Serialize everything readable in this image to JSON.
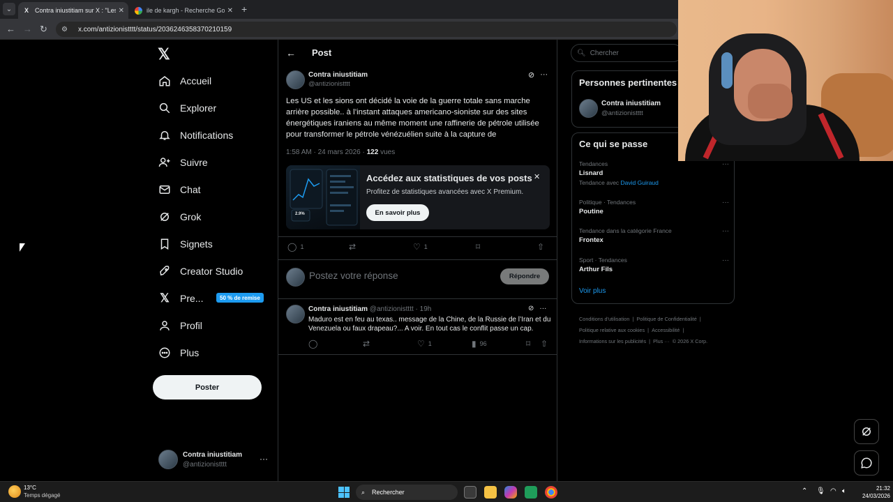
{
  "browser": {
    "tabs": [
      {
        "title": "Contra iniustitiam sur X : \"Les U",
        "favicon": "X"
      },
      {
        "title": "ile de kargh - Recherche Google",
        "favicon": "G"
      }
    ],
    "url": "x.com/antizionistttt/status/2036246358370210159"
  },
  "nav": {
    "items": [
      "Accueil",
      "Explorer",
      "Notifications",
      "Suivre",
      "Chat",
      "Grok",
      "Signets",
      "Creator Studio",
      "Pre...",
      "Profil",
      "Plus"
    ],
    "premium_badge": "50 % de remise",
    "post_button": "Poster",
    "account": {
      "name": "Contra iniustitiam",
      "handle": "@antizionistttt"
    }
  },
  "main": {
    "title": "Post",
    "post": {
      "author": "Contra iniustitiam",
      "handle": "@antizionistttt",
      "text": "Les US et les sions ont décidé la voie de la guerre totale sans marche arrière possible.. à l’instant attaques americano-sioniste sur des sites énergétiques iraniens au même moment une raffinerie de pétrole utilisée pour transformer le pétrole vénézuélien suite à la capture de",
      "time": "1:58 AM · 24 mars 2026 · ",
      "views": "122",
      "views_label": " vues",
      "replies": "1",
      "likes": "1"
    },
    "premium_card": {
      "title": "Accédez aux statistiques de vos posts",
      "subtitle": "Profitez de statistiques avancées avec X Premium.",
      "button": "En savoir plus",
      "img_stat": "2.9%"
    },
    "reply_box": {
      "placeholder": "Postez votre réponse",
      "button": "Répondre"
    },
    "reply": {
      "author": "Contra iniustitiam",
      "handle": "@antizionistttt",
      "time": "· 19h",
      "text": "Maduro est en feu au texas.. message de la Chine, de la Russie de l’Iran et du Venezuela ou faux drapeau?... A voir. En tout cas le conflit passe un cap.",
      "likes": "1",
      "views": "96"
    }
  },
  "right": {
    "search_placeholder": "Chercher",
    "people_title": "Personnes pertinentes",
    "person": {
      "name": "Contra iniustitiam",
      "handle": "@antizionistttt"
    },
    "trends_title": "Ce qui se passe",
    "trends": [
      {
        "category": "Tendances",
        "name": "Lisnard",
        "extra_prefix": "Tendance avec ",
        "extra_link": "David Guiraud"
      },
      {
        "category": "Politique · Tendances",
        "name": "Poutine"
      },
      {
        "category": "Tendance dans la catégorie France",
        "name": "Frontex"
      },
      {
        "category": "Sport · Tendances",
        "name": "Arthur Fils"
      }
    ],
    "see_more": "Voir plus",
    "footer": [
      "Conditions d'utilisation",
      "Politique de Confidentialité",
      "Politique relative aux cookies",
      "Accessibilité",
      "Informations sur les publicités",
      "Plus ···",
      "© 2026 X Corp."
    ]
  },
  "taskbar": {
    "temp": "13°C",
    "weather": "Temps dégagé",
    "search": "Rechercher",
    "time": "21:32",
    "date": "24/03/2026"
  },
  "colors": {
    "accent": "#1d9bf0",
    "bg": "#000000",
    "border": "#2f3336"
  }
}
